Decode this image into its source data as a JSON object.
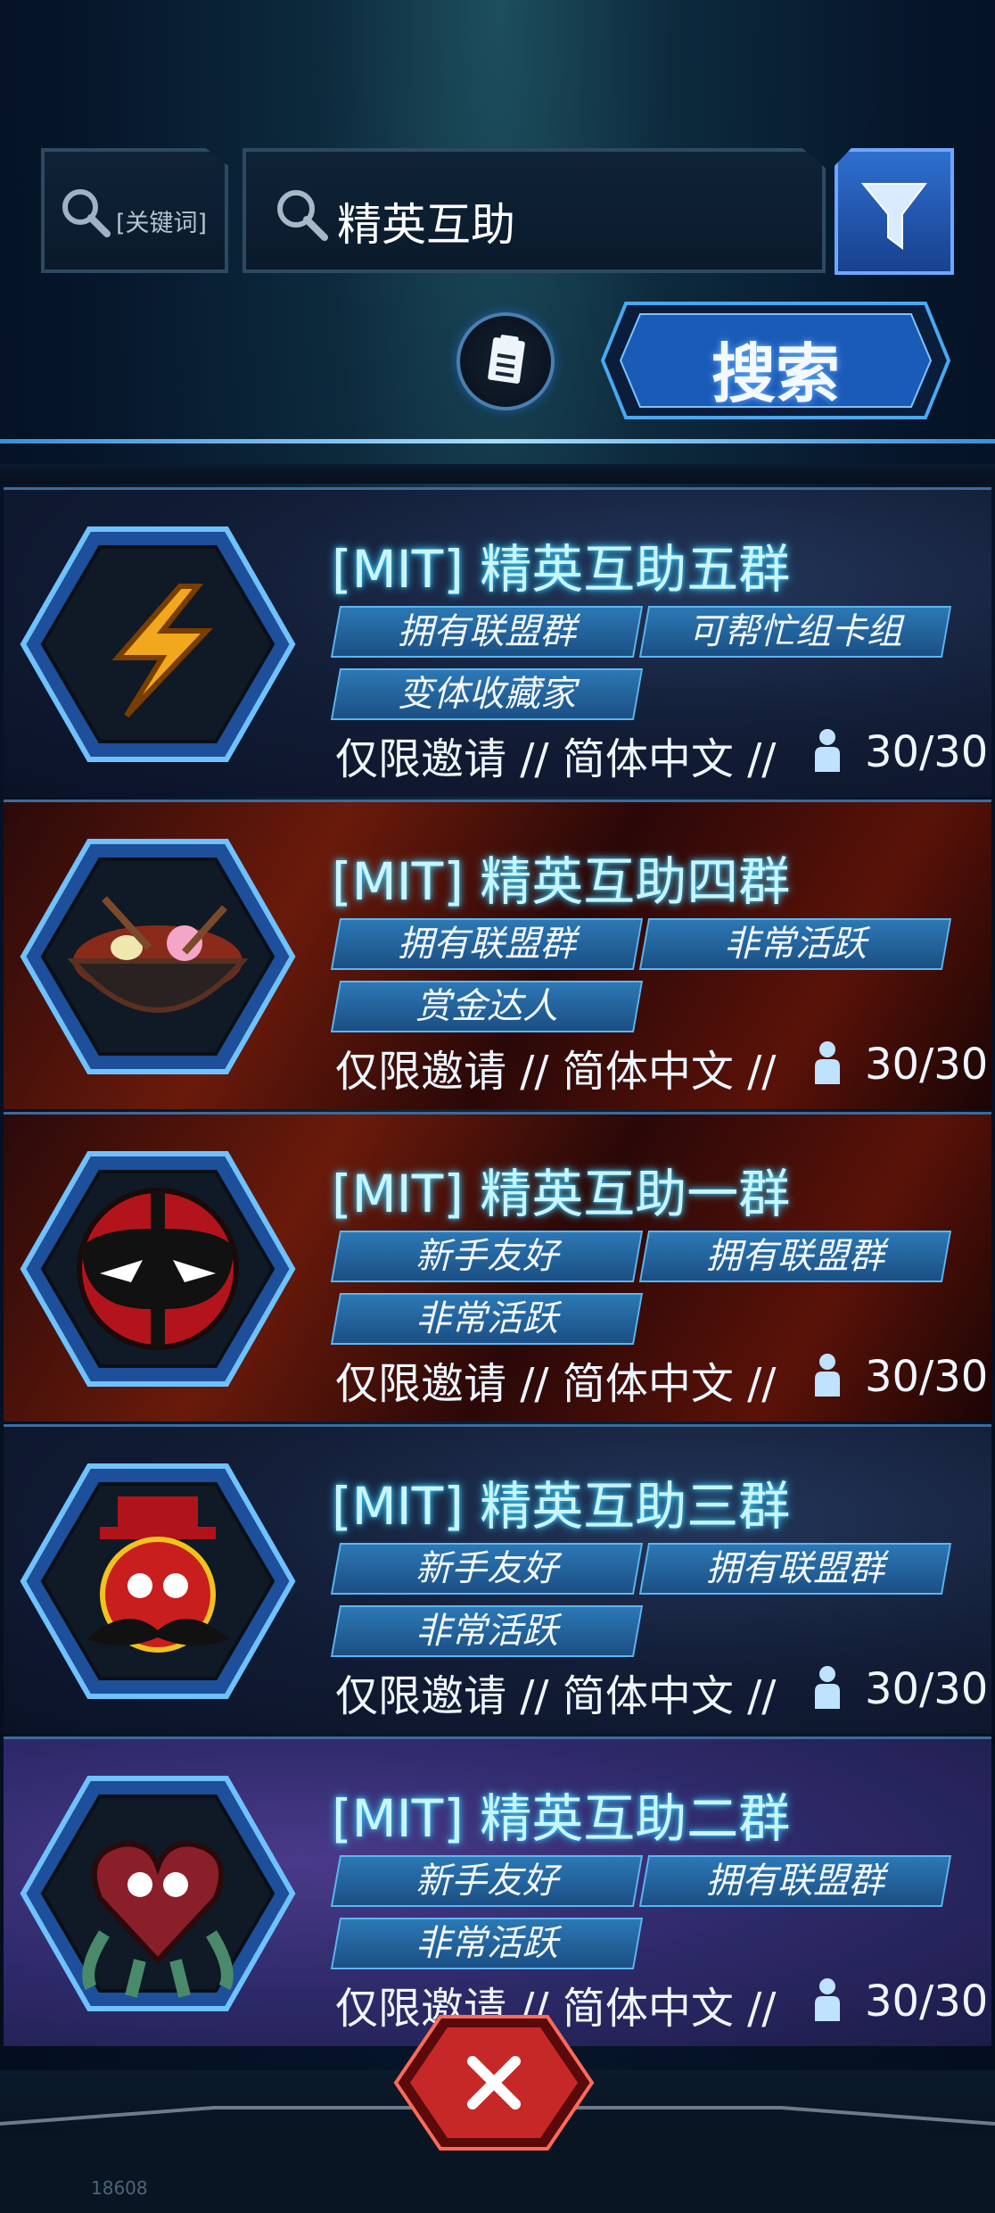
{
  "search": {
    "keyword_label": "[关键词]",
    "query": "精英互助",
    "button_label": "搜索"
  },
  "groups": [
    {
      "title": "[MIT] 精英互助五群",
      "tags": [
        "拥有联盟群",
        "可帮忙组卡组",
        "变体收藏家"
      ],
      "meta": "仅限邀请 // 简体中文 //",
      "members": "30/30",
      "icon": "lightning-icon",
      "theme": "space"
    },
    {
      "title": "[MIT] 精英互助四群",
      "tags": [
        "拥有联盟群",
        "非常活跃",
        "赏金达人"
      ],
      "meta": "仅限邀请 // 简体中文 //",
      "members": "30/30",
      "icon": "ramen-bowl-icon",
      "theme": "fire"
    },
    {
      "title": "[MIT] 精英互助一群",
      "tags": [
        "新手友好",
        "拥有联盟群",
        "非常活跃"
      ],
      "meta": "仅限邀请 // 简体中文 //",
      "members": "30/30",
      "icon": "deadpool-mask-icon",
      "theme": "fire"
    },
    {
      "title": "[MIT] 精英互助三群",
      "tags": [
        "新手友好",
        "拥有联盟群",
        "非常活跃"
      ],
      "meta": "仅限邀请 // 简体中文 //",
      "members": "30/30",
      "icon": "mustache-mascot-icon",
      "theme": "space"
    },
    {
      "title": "[MIT] 精英互助二群",
      "tags": [
        "新手友好",
        "拥有联盟群",
        "非常活跃"
      ],
      "meta": "仅限邀请 // 简体中文 //",
      "members": "30/30",
      "icon": "heart-creature-icon",
      "theme": "purple"
    }
  ],
  "footer": {
    "version": "18608"
  },
  "colors": {
    "accent": "#3fd1ff",
    "tag": "#2c78b5",
    "close": "#c62828"
  }
}
